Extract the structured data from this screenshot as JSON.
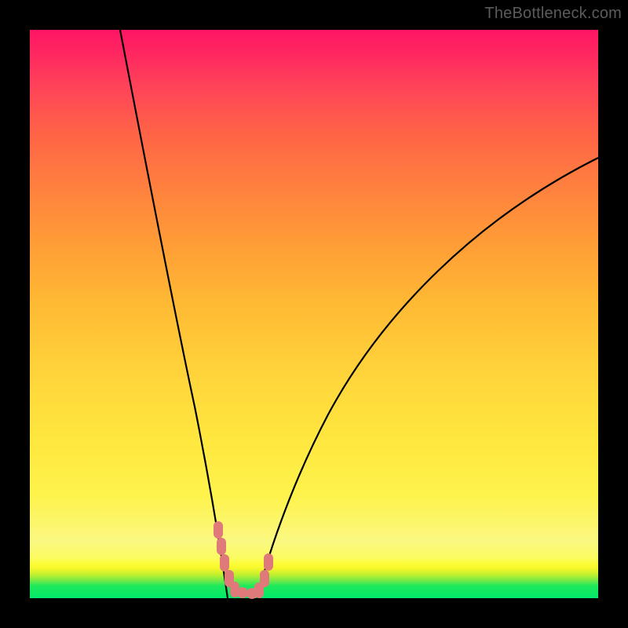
{
  "watermark": "TheBottleneck.com",
  "colors": {
    "frame": "#000000",
    "curve": "#000000",
    "marker": "#e07a7a"
  },
  "chart_data": {
    "type": "line",
    "title": "",
    "xlabel": "",
    "ylabel": "",
    "xlim": [
      0,
      100
    ],
    "ylim": [
      0,
      100
    ],
    "note": "No axis labels, tick labels, or units visible. Values below are estimated from pixel positions on a 0–100 normalized scale (x left→right, y bottom→top).",
    "series": [
      {
        "name": "left-curve",
        "x": [
          15.9,
          18.0,
          20.0,
          22.0,
          24.0,
          26.0,
          28.0,
          30.0,
          31.0,
          32.0,
          33.0,
          34.0,
          34.8
        ],
        "y": [
          100.0,
          86.0,
          74.0,
          62.0,
          50.0,
          39.0,
          28.0,
          18.0,
          13.5,
          9.4,
          5.7,
          2.5,
          0.0
        ]
      },
      {
        "name": "right-curve",
        "x": [
          40.0,
          42.0,
          45.0,
          48.0,
          52.0,
          56.0,
          60.0,
          65.0,
          70.0,
          75.0,
          80.0,
          85.0,
          90.0,
          95.0,
          100.0
        ],
        "y": [
          0.0,
          5.0,
          12.0,
          18.5,
          26.0,
          33.0,
          39.0,
          46.0,
          52.0,
          57.5,
          62.5,
          67.0,
          71.0,
          74.5,
          77.5
        ]
      }
    ],
    "markers": {
      "description": "Rounded salmon-colored blobs along the bottom of the V where the curves meet the floor.",
      "points_xy": [
        [
          33.0,
          13.0
        ],
        [
          33.5,
          10.0
        ],
        [
          34.1,
          7.1
        ],
        [
          34.9,
          4.2
        ],
        [
          35.8,
          2.1
        ],
        [
          37.2,
          1.3
        ],
        [
          38.7,
          1.1
        ],
        [
          39.9,
          1.9
        ],
        [
          40.9,
          4.3
        ],
        [
          41.6,
          7.3
        ]
      ]
    }
  }
}
